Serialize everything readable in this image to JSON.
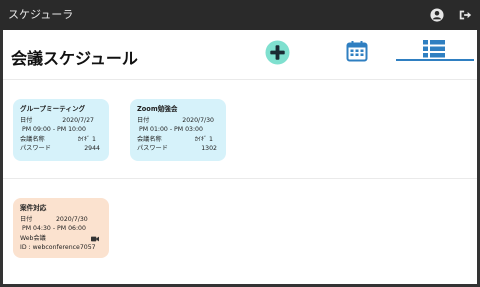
{
  "app": {
    "title": "スケジューラ"
  },
  "header": {
    "title": "会議スケジュール"
  },
  "colors": {
    "topbar": "#2a2a2a",
    "accent_blue": "#2f7fc1",
    "add_button": "#7fe0cf",
    "card_blue": "#d6f2fa",
    "card_orange": "#fbe2cf"
  },
  "icons": {
    "user": "user-circle-icon",
    "logout": "logout-icon",
    "add": "plus-icon",
    "calendar": "calendar-icon",
    "list": "list-icon",
    "video": "video-camera-icon"
  },
  "cards": [
    {
      "title": "グループミーティング",
      "date_label": "日付",
      "date": "2020/7/27",
      "time": "PM 09:00 - PM 10:00",
      "name_label": "会議名称",
      "name_value": "ｶｲｷﾞ 1",
      "password_label": "パスワード",
      "password": "2944"
    },
    {
      "title": "Zoom勉強会",
      "date_label": "日付",
      "date": "2020/7/30",
      "time": "PM 01:00 - PM 03:00",
      "name_label": "会議名称",
      "name_value": "ｶｲｷﾞ 1",
      "password_label": "パスワード",
      "password": "1302"
    },
    {
      "title": "案件対応",
      "date_label": "日付",
      "date": "2020/7/30",
      "time": "PM 04:30 - PM 06:00",
      "type": "Web会議",
      "id_line": "ID : webconference7057"
    }
  ]
}
